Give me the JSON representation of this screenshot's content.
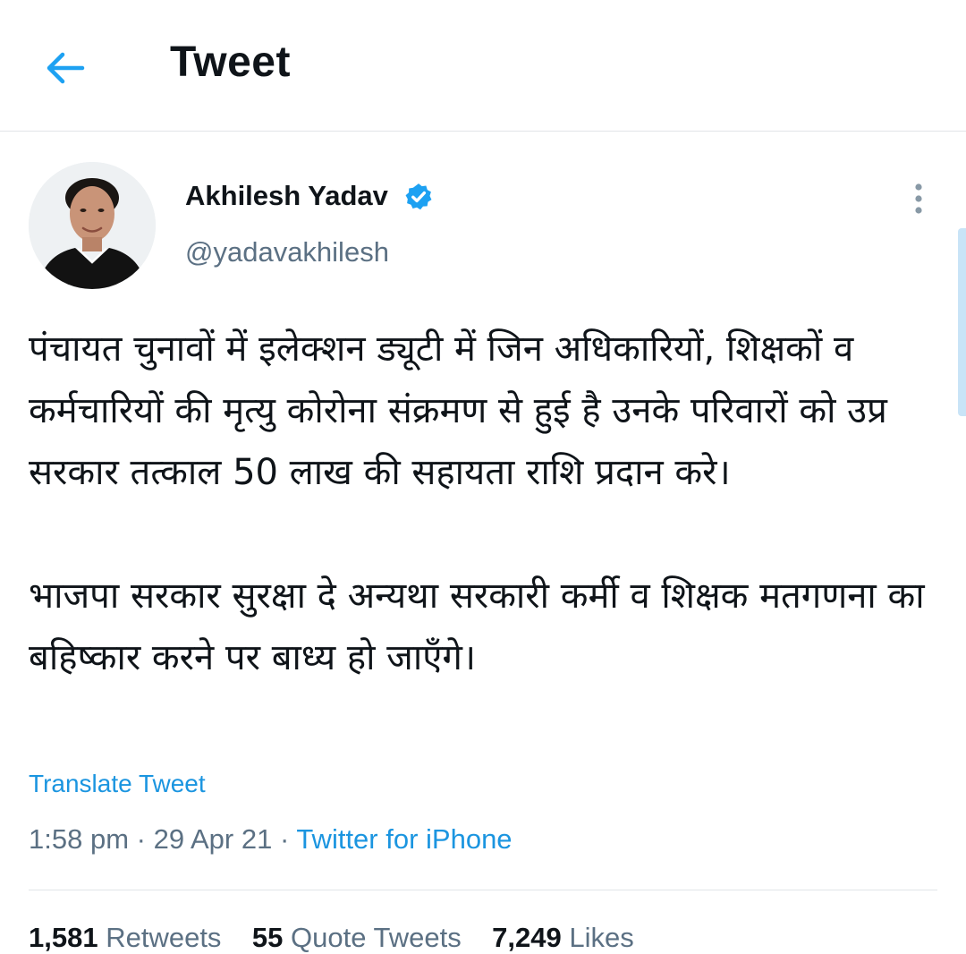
{
  "header": {
    "title": "Tweet",
    "back_icon": "arrow-left-icon",
    "accent_color": "#1da1f2"
  },
  "author": {
    "display_name": "Akhilesh Yadav",
    "handle": "@yadavakhilesh",
    "verified": true,
    "verified_icon": "verified-badge-icon",
    "avatar_icon": "profile-photo",
    "more_icon": "more-vertical-icon"
  },
  "tweet": {
    "paragraphs": [
      "पंचायत चुनावों में इलेक्शन ड्यूटी में जिन अधिकारियों, शिक्षकों व कर्मचारियों की मृत्यु कोरोना संक्रमण से हुई है उनके परिवारों को उप्र सरकार तत्काल 50 लाख की सहायता राशि प्रदान करे।",
      "भाजपा सरकार सुरक्षा दे अन्यथा सरकारी कर्मी व शिक्षक मतगणना का बहिष्कार करने पर बाध्य हो जाएँगे।"
    ],
    "translate_label": "Translate Tweet",
    "time": "1:58 pm",
    "date": "29 Apr 21",
    "separator": "·",
    "source": "Twitter for iPhone"
  },
  "stats": {
    "retweets_count": "1,581",
    "retweets_label": "Retweets",
    "quotes_count": "55",
    "quotes_label": "Quote Tweets",
    "likes_count": "7,249",
    "likes_label": "Likes"
  },
  "colors": {
    "link": "#1b95e0",
    "secondary_text": "#5b7083",
    "divider": "#e1e4e8"
  }
}
